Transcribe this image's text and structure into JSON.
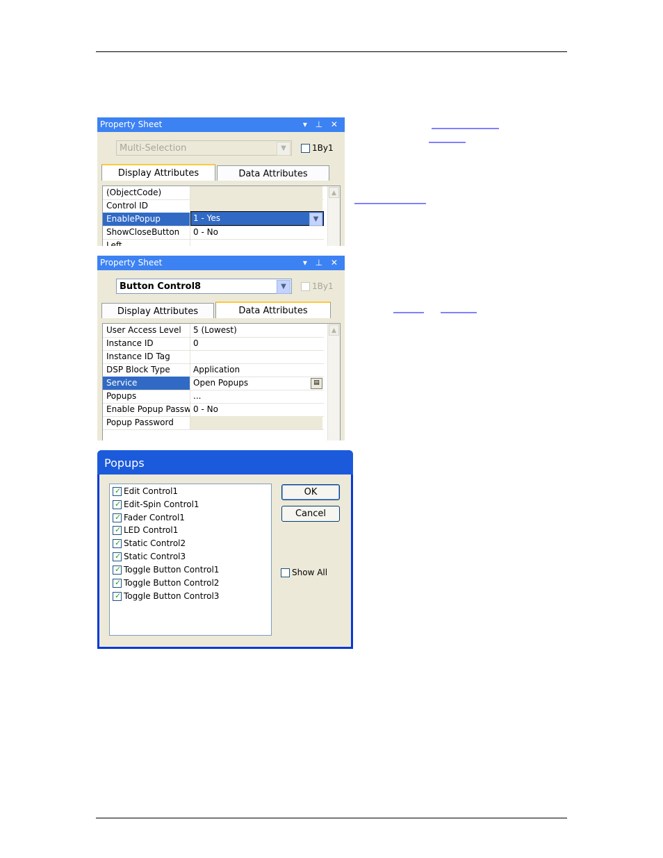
{
  "panel_top": {
    "title": "Property Sheet",
    "title_icons": "▾ ⊥ ✕",
    "object_combo": "Multi-Selection",
    "onebyone_label": "1By1",
    "tabs": [
      "Display Attributes",
      "Data Attributes"
    ],
    "rows": [
      {
        "key": "(ObjectCode)",
        "value": ""
      },
      {
        "key": "Control ID",
        "value": ""
      },
      {
        "key": "EnablePopup",
        "value": "1 - Yes"
      },
      {
        "key": "ShowCloseButton",
        "value": "0 - No"
      },
      {
        "key": "Left",
        "value": ""
      }
    ]
  },
  "panel_bottom": {
    "title": "Property Sheet",
    "title_icons": "▾ ⊥ ✕",
    "object_combo": "Button Control8",
    "onebyone_label": "1By1",
    "tabs": [
      "Display Attributes",
      "Data Attributes"
    ],
    "rows": [
      {
        "key": "User Access Level",
        "value": "5 (Lowest)"
      },
      {
        "key": "Instance ID",
        "value": "0"
      },
      {
        "key": "Instance ID Tag",
        "value": ""
      },
      {
        "key": "DSP Block Type",
        "value": "Application"
      },
      {
        "key": "Service",
        "value": "Open Popups"
      },
      {
        "key": "Popups",
        "value": "..."
      },
      {
        "key": "Enable Popup Passw",
        "value": "0 - No"
      },
      {
        "key": "Popup Password",
        "value": ""
      }
    ]
  },
  "dialog": {
    "title": "Popups",
    "items": [
      "Edit Control1",
      "Edit-Spin Control1",
      "Fader Control1",
      "LED Control1",
      "Static Control2",
      "Static Control3",
      "Toggle Button Control1",
      "Toggle Button Control2",
      "Toggle Button Control3"
    ],
    "ok_label": "OK",
    "cancel_label": "Cancel",
    "show_all_label": "Show All"
  },
  "colors": {
    "titlebar": "#3d82f2",
    "selection": "#316ac5",
    "dialog_frame": "#0839d6",
    "link": "#0000ff"
  }
}
